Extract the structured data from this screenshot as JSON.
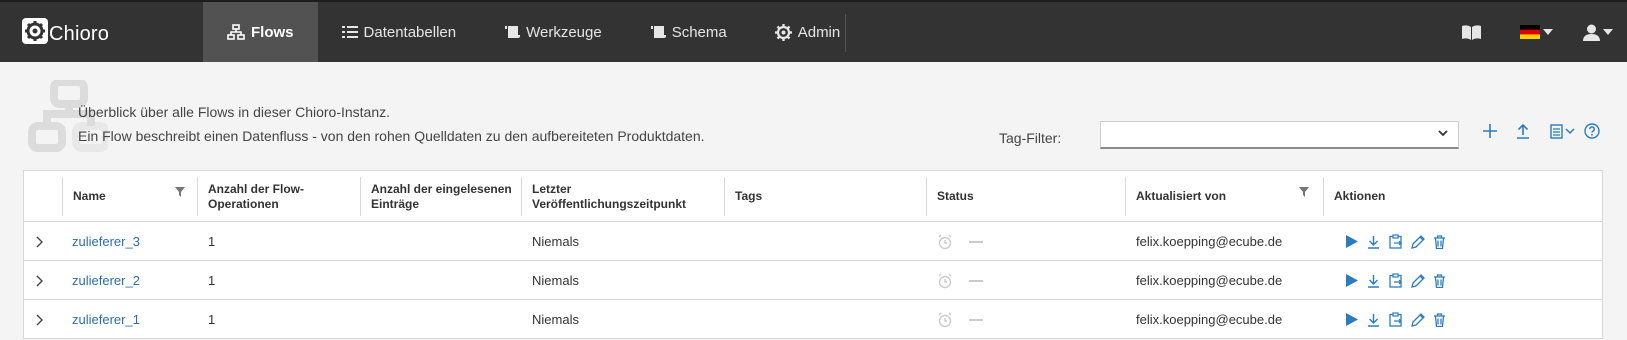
{
  "app": {
    "name": "Chioro"
  },
  "nav": {
    "items": [
      {
        "label": "Flows",
        "icon": "sitemap-icon",
        "active": true
      },
      {
        "label": "Datentabellen",
        "icon": "list-icon",
        "active": false
      },
      {
        "label": "Werkzeuge",
        "icon": "scroll-icon",
        "active": false
      },
      {
        "label": "Schema",
        "icon": "scroll-icon",
        "active": false
      },
      {
        "label": "Admin",
        "icon": "gear-icon",
        "active": false
      }
    ]
  },
  "header_right": {
    "icons": [
      "book-icon",
      "german-flag-icon",
      "user-icon"
    ]
  },
  "intro": {
    "line1": "Überblick über alle Flows in dieser Chioro-Instanz.",
    "line2": "Ein Flow beschreibt einen Datenfluss - von den rohen Quelldaten zu den aufbereiteten Produktdaten."
  },
  "tag_filter": {
    "label": "Tag-Filter:",
    "value": ""
  },
  "toolbar_icons": [
    "plus-icon",
    "upload-icon",
    "columns-menu-icon",
    "help-icon"
  ],
  "table": {
    "columns": {
      "name": "Name",
      "ops": "Anzahl der Flow-Operationen",
      "entries": "Anzahl der eingelesenen Einträge",
      "published": "Letzter Veröffentlichungszeitpunkt",
      "tags": "Tags",
      "status": "Status",
      "updated_by": "Aktualisiert von",
      "actions": "Aktionen"
    },
    "rows": [
      {
        "name": "zulieferer_3",
        "ops": "1",
        "entries": "",
        "published": "Niemals",
        "tags": "",
        "updated_by": "felix.koepping@ecube.de"
      },
      {
        "name": "zulieferer_2",
        "ops": "1",
        "entries": "",
        "published": "Niemals",
        "tags": "",
        "updated_by": "felix.koepping@ecube.de"
      },
      {
        "name": "zulieferer_1",
        "ops": "1",
        "entries": "",
        "published": "Niemals",
        "tags": "",
        "updated_by": "felix.koepping@ecube.de"
      }
    ]
  },
  "colors": {
    "topbar": "#333333",
    "active_nav": "#525252",
    "accent": "#2b7bbf",
    "link": "#2b6fa8"
  }
}
